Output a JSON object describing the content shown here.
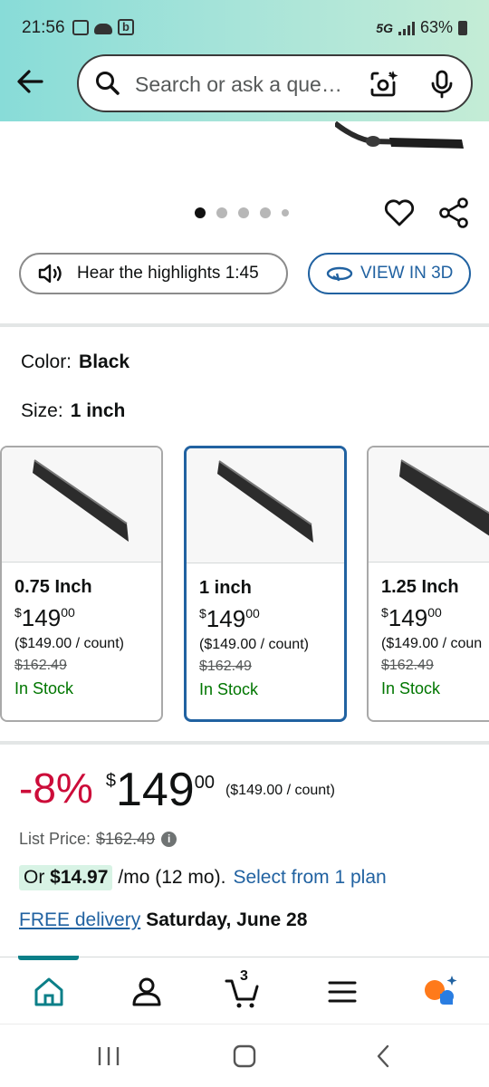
{
  "status_bar": {
    "time": "21:56",
    "network": "5G",
    "battery": "63%",
    "icons": [
      "gallery-icon",
      "cloud-icon",
      "b-app-icon",
      "signal-icon",
      "battery-icon"
    ]
  },
  "search": {
    "placeholder": "Search or ask a que…",
    "icons": [
      "back-arrow-icon",
      "search-icon",
      "camera-icon",
      "mic-icon"
    ]
  },
  "carousel": {
    "total_dots": 5,
    "active_index": 0
  },
  "actions": {
    "hear_label": "Hear the highlights 1:45",
    "view3d_label": "VIEW IN 3D"
  },
  "attributes": {
    "color_label": "Color:",
    "color_value": "Black",
    "size_label": "Size:",
    "size_value": "1 inch"
  },
  "size_options": [
    {
      "name": "0.75 Inch",
      "price_whole": "149",
      "price_frac": "00",
      "currency": "$",
      "unit_price": "($149.00 / count)",
      "list_price": "$162.49",
      "stock": "In Stock",
      "selected": false
    },
    {
      "name": "1 inch",
      "price_whole": "149",
      "price_frac": "00",
      "currency": "$",
      "unit_price": "($149.00 / count)",
      "list_price": "$162.49",
      "stock": "In Stock",
      "selected": true
    },
    {
      "name": "1.25 Inch",
      "price_whole": "149",
      "price_frac": "00",
      "currency": "$",
      "unit_price": "($149.00 / coun",
      "list_price": "$162.49",
      "stock": "In Stock",
      "selected": false
    }
  ],
  "price": {
    "discount": "-8%",
    "currency": "$",
    "whole": "149",
    "fraction": "00",
    "per_unit": "($149.00 / count)",
    "list_label": "List Price:",
    "list_value": "$162.49",
    "info_icon": "i"
  },
  "plan": {
    "or_label": "Or",
    "monthly": "$14.97",
    "terms": "/mo (12 mo).",
    "link": "Select from 1 plan"
  },
  "delivery": {
    "free_label": "FREE delivery",
    "date": "Saturday, June 28"
  },
  "bottom_nav": {
    "items": [
      "home",
      "account",
      "cart",
      "menu",
      "rufus"
    ],
    "cart_count": "3",
    "active": "home"
  },
  "colors": {
    "accent_blue": "#2162a1",
    "discount_red": "#cc0c39",
    "stock_green": "#007600",
    "teal": "#0b7f88",
    "header_gradient_start": "#88dcd8",
    "header_gradient_end": "#c4ecd6"
  }
}
